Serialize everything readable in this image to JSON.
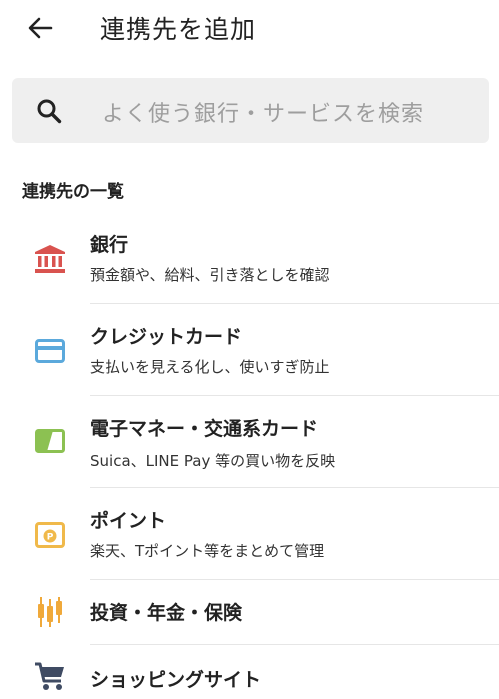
{
  "header": {
    "back_icon": "arrow-left-icon",
    "title": "連携先を追加"
  },
  "search": {
    "icon": "search-icon",
    "placeholder": "よく使う銀行・サービスを検索"
  },
  "section": {
    "title": "連携先の一覧"
  },
  "items": [
    {
      "icon": "bank-icon",
      "title": "銀行",
      "subtitle": "預金額や、給料、引き落としを確認",
      "color": "#d9534f"
    },
    {
      "icon": "credit-card-icon",
      "title": "クレジットカード",
      "subtitle": "支払いを見える化し、使いすぎ防止",
      "color": "#5ba9dc"
    },
    {
      "icon": "emoney-card-icon",
      "title": "電子マネー・交通系カード",
      "subtitle": "Suica、LINE Pay 等の買い物を反映",
      "color": "#8cc152"
    },
    {
      "icon": "point-card-icon",
      "title": "ポイント",
      "subtitle": "楽天、Tポイント等をまとめて管理",
      "color": "#f0b94a"
    },
    {
      "icon": "investment-icon",
      "title": "投資・年金・保険",
      "subtitle": "",
      "color": "#f0a93a"
    },
    {
      "icon": "shopping-cart-icon",
      "title": "ショッピングサイト",
      "subtitle": "",
      "color": "#3f4b63"
    }
  ]
}
